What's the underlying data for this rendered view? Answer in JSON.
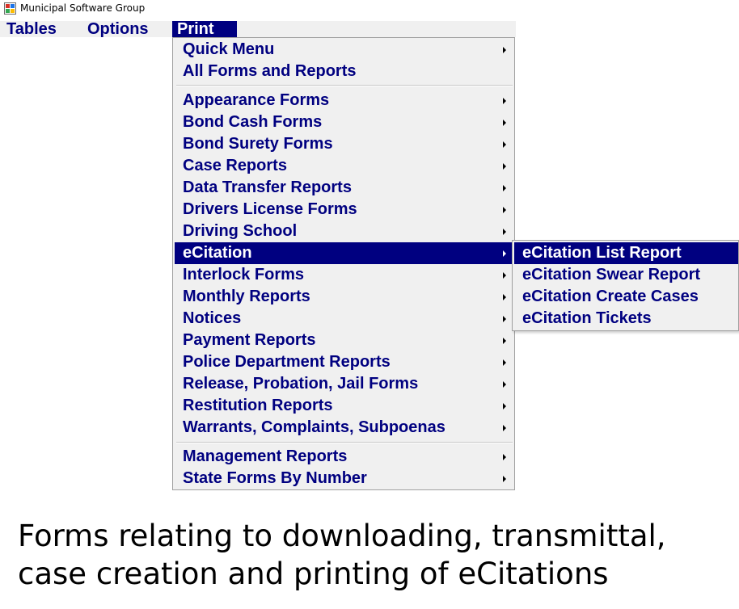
{
  "window": {
    "title": "Municipal Software Group",
    "icon": "app-window-icon"
  },
  "menubar": {
    "items": [
      "Tables",
      "Options",
      "Print"
    ],
    "active": "Print"
  },
  "print_menu": {
    "group1": [
      "Quick Menu",
      "All Forms and Reports"
    ],
    "group2": [
      "Appearance Forms",
      "Bond Cash Forms",
      "Bond Surety Forms",
      "Case Reports",
      "Data Transfer Reports",
      "Drivers License Forms",
      "Driving School",
      "eCitation",
      "Interlock Forms",
      "Monthly Reports",
      "Notices",
      "Payment Reports",
      "Police Department Reports",
      "Release, Probation, Jail Forms",
      "Restitution Reports",
      "Warrants, Complaints, Subpoenas"
    ],
    "group3": [
      "Management Reports",
      "State Forms By Number"
    ],
    "highlighted": "eCitation"
  },
  "ecitation_submenu": {
    "items": [
      "eCitation List Report",
      "eCitation Swear Report",
      "eCitation Create Cases",
      "eCitation Tickets"
    ],
    "highlighted": "eCitation List Report"
  },
  "caption": "Forms relating to downloading, transmittal, case creation and printing of eCitations",
  "colors": {
    "menu_text": "#000080",
    "highlight_bg": "#000080",
    "menu_bg": "#f0f0f0"
  }
}
